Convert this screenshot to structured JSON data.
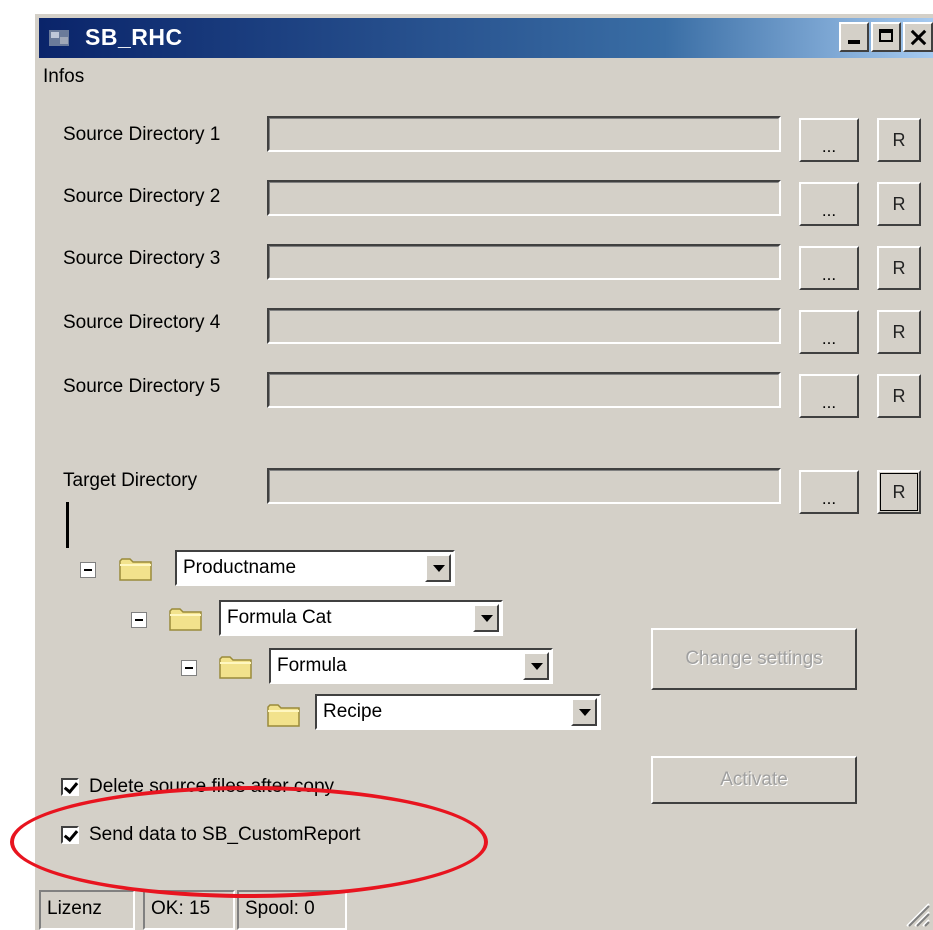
{
  "window": {
    "title": "SB_RHC"
  },
  "menu": {
    "items": [
      "Infos"
    ]
  },
  "sources": [
    {
      "label": "Source Directory 1",
      "value": "",
      "browse_label": "...",
      "reset_label": "R"
    },
    {
      "label": "Source Directory 2",
      "value": "",
      "browse_label": "...",
      "reset_label": "R"
    },
    {
      "label": "Source Directory 3",
      "value": "",
      "browse_label": "...",
      "reset_label": "R"
    },
    {
      "label": "Source Directory 4",
      "value": "",
      "browse_label": "...",
      "reset_label": "R"
    },
    {
      "label": "Source Directory 5",
      "value": "",
      "browse_label": "...",
      "reset_label": "R"
    }
  ],
  "target": {
    "label": "Target Directory",
    "value": "",
    "browse_label": "...",
    "reset_label": "R"
  },
  "tree": {
    "level1": "Productname",
    "level2": "Formula Cat",
    "level3": "Formula",
    "level4": "Recipe"
  },
  "buttons": {
    "change_settings": "Change settings",
    "activate": "Activate"
  },
  "options": {
    "delete_source": {
      "label": "Delete source files after copy",
      "checked": true
    },
    "send_data": {
      "label": "Send data to SB_CustomReport",
      "checked": true
    }
  },
  "status": {
    "license": "Lizenz",
    "ok": "OK: 15",
    "spool": "Spool: 0"
  },
  "colors": {
    "highlight": "#e8141f",
    "titlebar_start": "#0a246a",
    "face": "#d4d0c8"
  }
}
